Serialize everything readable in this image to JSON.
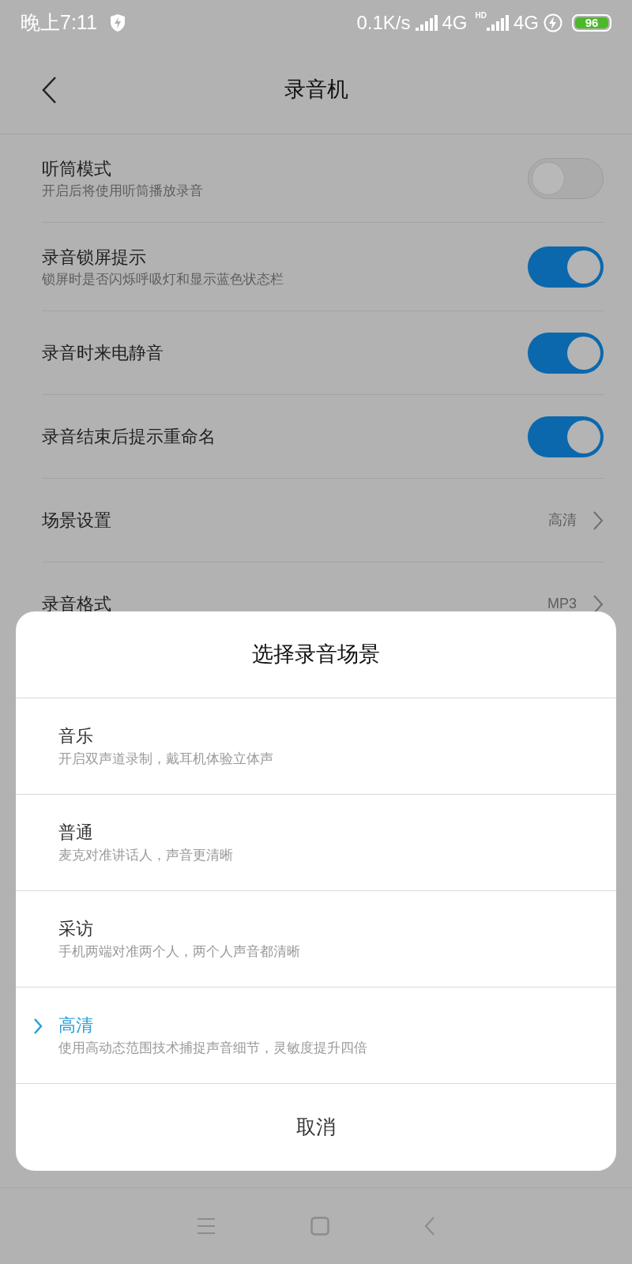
{
  "status_bar": {
    "time": "晚上7:11",
    "net_speed": "0.1K/s",
    "network_1": "4G",
    "hd": "HD",
    "network_2": "4G",
    "battery": "96"
  },
  "header": {
    "title": "录音机"
  },
  "settings": [
    {
      "kind": "toggle",
      "title": "听筒模式",
      "subtitle": "开启后将使用听筒播放录音",
      "on": false
    },
    {
      "kind": "toggle",
      "title": "录音锁屏提示",
      "subtitle": "锁屏时是否闪烁呼吸灯和显示蓝色状态栏",
      "on": true
    },
    {
      "kind": "toggle",
      "title": "录音时来电静音",
      "on": true
    },
    {
      "kind": "toggle",
      "title": "录音结束后提示重命名",
      "on": true
    },
    {
      "kind": "link",
      "title": "场景设置",
      "value": "高清"
    },
    {
      "kind": "link",
      "title": "录音格式",
      "value": "MP3"
    }
  ],
  "dialog": {
    "title": "选择录音场景",
    "options": [
      {
        "title": "音乐",
        "subtitle": "开启双声道录制，戴耳机体验立体声",
        "selected": false
      },
      {
        "title": "普通",
        "subtitle": "麦克对准讲话人，声音更清晰",
        "selected": false
      },
      {
        "title": "采访",
        "subtitle": "手机两端对准两个人，两个人声音都清晰",
        "selected": false
      },
      {
        "title": "高清",
        "subtitle": "使用高动态范围技术捕捉声音细节，灵敏度提升四倍",
        "selected": true
      }
    ],
    "cancel": "取消"
  }
}
